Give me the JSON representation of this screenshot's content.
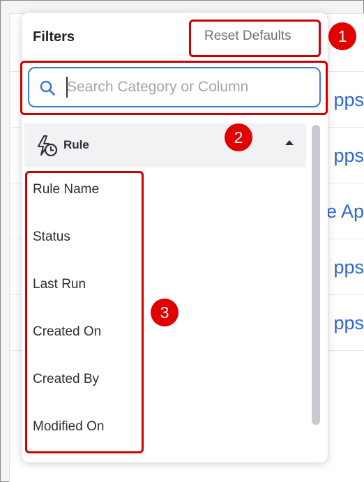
{
  "background": {
    "link_fragments": [
      "pps",
      "pps",
      "e Ap",
      "pps",
      "pps"
    ]
  },
  "filters": {
    "title": "Filters",
    "reset_label": "Reset Defaults",
    "search": {
      "placeholder": "Search Category or Column",
      "value": ""
    },
    "category": {
      "label": "Rule",
      "icon": "rule-lightning-clock-icon",
      "expanded": true,
      "items": [
        "Rule Name",
        "Status",
        "Last Run",
        "Created On",
        "Created By",
        "Modified On"
      ]
    }
  },
  "annotations": {
    "badges": [
      "1",
      "2",
      "3"
    ]
  },
  "colors": {
    "accent": "#3a78d9",
    "annotation": "#cc0000",
    "badge": "#e00000",
    "link": "#2f66d0"
  }
}
